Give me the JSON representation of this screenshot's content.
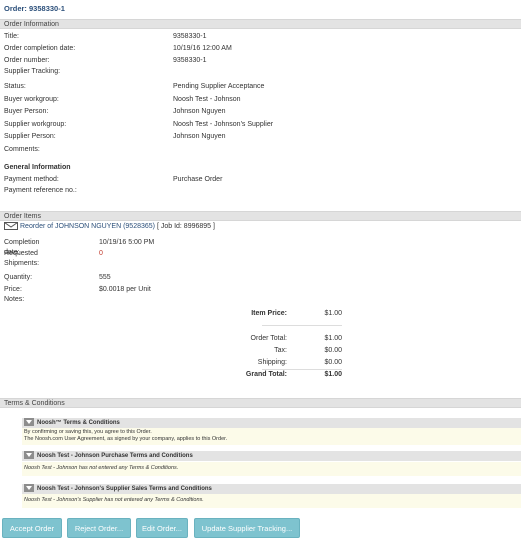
{
  "order_header": "Order: 9358330-1",
  "order_info": {
    "section_title": "Order Information",
    "rows": [
      {
        "label": "Title:",
        "value": "9358330-1"
      },
      {
        "label": "Order completion date:",
        "value": "10/19/16 12:00 AM"
      },
      {
        "label": "Order number:",
        "value": "9358330-1"
      },
      {
        "label": "Supplier Tracking:",
        "value": ""
      },
      {
        "label": "Status:",
        "value": "Pending Supplier Acceptance"
      },
      {
        "label": "Buyer workgroup:",
        "value": "Noosh Test - Johnson"
      },
      {
        "label": "Buyer Person:",
        "value": "Johnson Nguyen"
      },
      {
        "label": "Supplier workgroup:",
        "value": "Noosh Test - Johnson's Supplier"
      },
      {
        "label": "Supplier Person:",
        "value": "Johnson Nguyen"
      },
      {
        "label": "Comments:",
        "value": ""
      }
    ]
  },
  "general_info": {
    "title": "General Information",
    "rows": [
      {
        "label": "Payment method:",
        "value": "Purchase Order"
      },
      {
        "label": "Payment reference no.:",
        "value": ""
      }
    ]
  },
  "order_items": {
    "section_title": "Order Items",
    "item_link": "Reorder of JOHNSON NGUYEN (9528365)",
    "job_id": "[ Job Id: 8996895 ]",
    "completion_label": "Completion date:",
    "completion_value": "10/19/16 5:00 PM",
    "shipments_label": "Requested Shipments:",
    "shipments_value": "0",
    "quantity_label": "Quantity:",
    "quantity_value": "555",
    "price_label": "Price:",
    "price_value": "$0.0018 per Unit",
    "notes_label": "Notes:"
  },
  "totals": {
    "item_price_label": "Item Price:",
    "item_price_value": "$1.00",
    "order_total_label": "Order Total:",
    "order_total_value": "$1.00",
    "tax_label": "Tax:",
    "tax_value": "$0.00",
    "shipping_label": "Shipping:",
    "shipping_value": "$0.00",
    "grand_total_label": "Grand Total:",
    "grand_total_value": "$1.00"
  },
  "terms": {
    "section_title": "Terms & Conditions",
    "blocks": [
      {
        "title": "Noosh™ Terms & Conditions",
        "line1": "By confirming or saving this, you agree to this Order.",
        "line2": "The Noosh.com User Agreement, as signed by your company, applies to this Order."
      },
      {
        "title": "Noosh Test - Johnson Purchase Terms and Conditions",
        "line1": "Noosh Test - Johnson has not entered any Terms & Conditions."
      },
      {
        "title": "Noosh Test - Johnson's Supplier Sales Terms and Conditions",
        "line1": "Noosh Test - Johnson's Supplier has not entered any Terms & Conditions."
      }
    ]
  },
  "buttons": {
    "accept": "Accept Order",
    "reject": "Reject Order...",
    "edit": "Edit Order...",
    "update_tracking": "Update Supplier Tracking..."
  },
  "colors": {
    "link": "#2b4f7a",
    "section_bar": "#e3e3e3",
    "button": "#7ec3cf",
    "terms_body_bg": "#fcfbe9",
    "zero_value": "#c0392b"
  },
  "icons": {
    "item": "envelope-icon",
    "terms_toggle": "collapse-toggle-icon"
  }
}
